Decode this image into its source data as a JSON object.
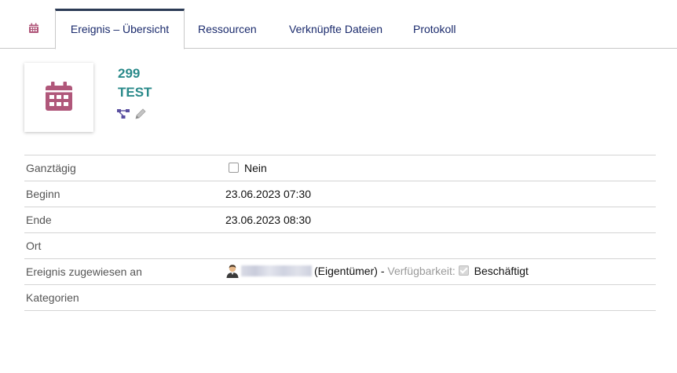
{
  "tabs": [
    {
      "label": "Ereignis – Übersicht",
      "active": true
    },
    {
      "label": "Ressourcen"
    },
    {
      "label": "Verknüpfte Dateien"
    },
    {
      "label": "Protokoll"
    }
  ],
  "event": {
    "id": "299",
    "title": "TEST"
  },
  "fields": {
    "all_day": {
      "label": "Ganztägig",
      "value": "Nein",
      "checked": false
    },
    "start": {
      "label": "Beginn",
      "value": "23.06.2023 07:30"
    },
    "end": {
      "label": "Ende",
      "value": "23.06.2023 08:30"
    },
    "location": {
      "label": "Ort",
      "value": ""
    },
    "assigned": {
      "label": "Ereignis zugewiesen an",
      "owner_suffix": "(Eigentümer)",
      "separator": "-",
      "availability_label": "Verfügbarkeit:",
      "availability_value": "Beschäftigt",
      "availability_checked": true
    },
    "categories": {
      "label": "Kategorien",
      "value": ""
    }
  },
  "colors": {
    "accent": "#2a8a8a",
    "icon": "#b0577a",
    "tab_text": "#1a2a6c",
    "active_tab_border": "#2b3a55"
  }
}
